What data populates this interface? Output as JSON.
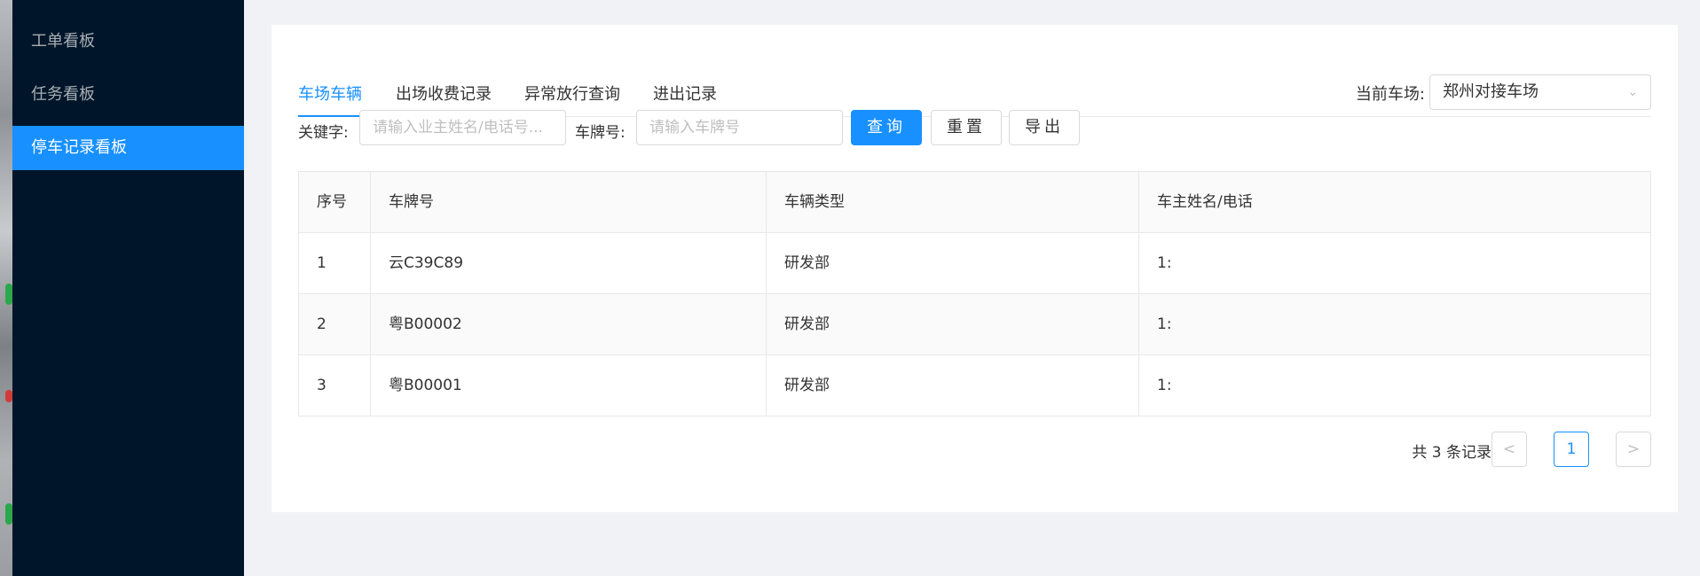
{
  "sidebar": {
    "items": [
      {
        "label": "工单看板"
      },
      {
        "label": "任务看板"
      },
      {
        "label": "停车记录看板",
        "active": true
      }
    ]
  },
  "tabs": [
    {
      "label": "车场车辆",
      "active": true
    },
    {
      "label": "出场收费记录"
    },
    {
      "label": "异常放行查询"
    },
    {
      "label": "进出记录"
    }
  ],
  "lot": {
    "label": "当前车场:",
    "value": "郑州对接车场",
    "icon": "chevron-down-icon"
  },
  "filters": {
    "keyword_label": "关键字:",
    "keyword_placeholder": "请输入业主姓名/电话号...",
    "plate_label": "车牌号:",
    "plate_placeholder": "请输入车牌号",
    "query_button": "查询",
    "reset_button": "重置",
    "export_button": "导出"
  },
  "table": {
    "columns": [
      "序号",
      "车牌号",
      "车辆类型",
      "车主姓名/电话"
    ],
    "rows": [
      [
        "1",
        "云C39C89",
        "研发部",
        "1:"
      ],
      [
        "2",
        "粤B00002",
        "研发部",
        "1:"
      ],
      [
        "3",
        "粤B00001",
        "研发部",
        "1:"
      ]
    ]
  },
  "pagination": {
    "total_text": "共 3 条记录",
    "prev": "<",
    "current_page": "1",
    "next": ">"
  },
  "colors": {
    "accent": "#1890ff",
    "sidebar_bg": "#001529",
    "page_bg": "#f0f2f5"
  }
}
